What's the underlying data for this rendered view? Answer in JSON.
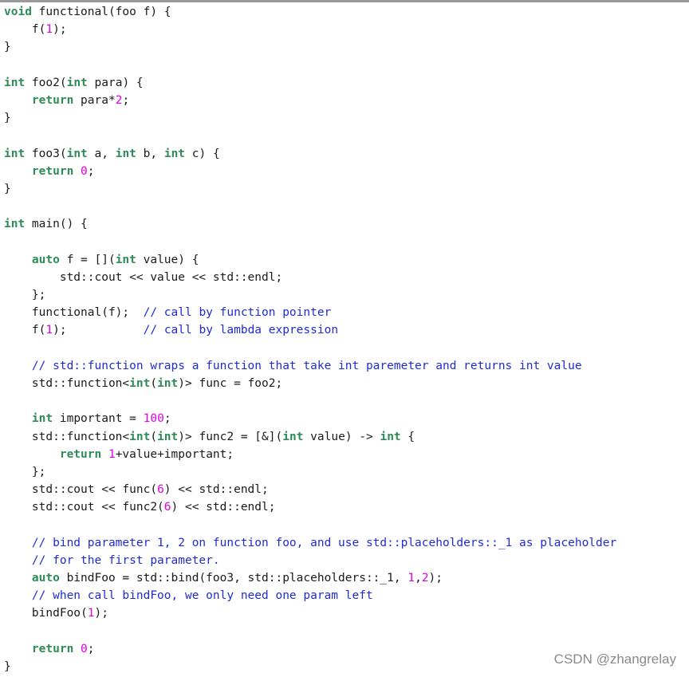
{
  "watermark": "CSDN @zhangrelay",
  "colors": {
    "keyword": "#2e8b57",
    "number": "#e000e0",
    "comment": "#1e2bd8",
    "text": "#1a1a1a",
    "background": "#ffffff"
  },
  "lines": [
    [
      [
        "kw",
        "void"
      ],
      [
        "t",
        " functional(foo f) {"
      ]
    ],
    [
      [
        "t",
        "    f("
      ],
      [
        "num",
        "1"
      ],
      [
        "t",
        ");"
      ]
    ],
    [
      [
        "t",
        "}"
      ]
    ],
    [],
    [
      [
        "kw",
        "int"
      ],
      [
        "t",
        " foo2("
      ],
      [
        "kw",
        "int"
      ],
      [
        "t",
        " para) {"
      ]
    ],
    [
      [
        "t",
        "    "
      ],
      [
        "kw",
        "return"
      ],
      [
        "t",
        " para*"
      ],
      [
        "num",
        "2"
      ],
      [
        "t",
        ";"
      ]
    ],
    [
      [
        "t",
        "}"
      ]
    ],
    [],
    [
      [
        "kw",
        "int"
      ],
      [
        "t",
        " foo3("
      ],
      [
        "kw",
        "int"
      ],
      [
        "t",
        " a, "
      ],
      [
        "kw",
        "int"
      ],
      [
        "t",
        " b, "
      ],
      [
        "kw",
        "int"
      ],
      [
        "t",
        " c) {"
      ]
    ],
    [
      [
        "t",
        "    "
      ],
      [
        "kw",
        "return"
      ],
      [
        "t",
        " "
      ],
      [
        "num",
        "0"
      ],
      [
        "t",
        ";"
      ]
    ],
    [
      [
        "t",
        "}"
      ]
    ],
    [],
    [
      [
        "kw",
        "int"
      ],
      [
        "t",
        " main() {"
      ]
    ],
    [],
    [
      [
        "t",
        "    "
      ],
      [
        "kw",
        "auto"
      ],
      [
        "t",
        " f = []("
      ],
      [
        "kw",
        "int"
      ],
      [
        "t",
        " value) {"
      ]
    ],
    [
      [
        "t",
        "        std::cout << value << std::endl;"
      ]
    ],
    [
      [
        "t",
        "    };"
      ]
    ],
    [
      [
        "t",
        "    functional(f);  "
      ],
      [
        "cm",
        "// call by function pointer"
      ]
    ],
    [
      [
        "t",
        "    f("
      ],
      [
        "num",
        "1"
      ],
      [
        "t",
        ");           "
      ],
      [
        "cm",
        "// call by lambda expression"
      ]
    ],
    [],
    [
      [
        "t",
        "    "
      ],
      [
        "cm",
        "// std::function wraps a function that take int paremeter and returns int value"
      ]
    ],
    [
      [
        "t",
        "    std::function<"
      ],
      [
        "kw",
        "int"
      ],
      [
        "t",
        "("
      ],
      [
        "kw",
        "int"
      ],
      [
        "t",
        ")> func = foo2;"
      ]
    ],
    [],
    [
      [
        "t",
        "    "
      ],
      [
        "kw",
        "int"
      ],
      [
        "t",
        " important = "
      ],
      [
        "num",
        "100"
      ],
      [
        "t",
        ";"
      ]
    ],
    [
      [
        "t",
        "    std::function<"
      ],
      [
        "kw",
        "int"
      ],
      [
        "t",
        "("
      ],
      [
        "kw",
        "int"
      ],
      [
        "t",
        ")> func2 = [&]("
      ],
      [
        "kw",
        "int"
      ],
      [
        "t",
        " value) -> "
      ],
      [
        "kw",
        "int"
      ],
      [
        "t",
        " {"
      ]
    ],
    [
      [
        "t",
        "        "
      ],
      [
        "kw",
        "return"
      ],
      [
        "t",
        " "
      ],
      [
        "num",
        "1"
      ],
      [
        "t",
        "+value+important;"
      ]
    ],
    [
      [
        "t",
        "    };"
      ]
    ],
    [
      [
        "t",
        "    std::cout << func("
      ],
      [
        "num",
        "6"
      ],
      [
        "t",
        ") << std::endl;"
      ]
    ],
    [
      [
        "t",
        "    std::cout << func2("
      ],
      [
        "num",
        "6"
      ],
      [
        "t",
        ") << std::endl;"
      ]
    ],
    [],
    [
      [
        "t",
        "    "
      ],
      [
        "cm",
        "// bind parameter 1, 2 on function foo, and use std::placeholders::_1 as placeholder"
      ]
    ],
    [
      [
        "t",
        "    "
      ],
      [
        "cm",
        "// for the first parameter."
      ]
    ],
    [
      [
        "t",
        "    "
      ],
      [
        "kw",
        "auto"
      ],
      [
        "t",
        " bindFoo = std::bind(foo3, std::placeholders::_1, "
      ],
      [
        "num",
        "1"
      ],
      [
        "t",
        ","
      ],
      [
        "num",
        "2"
      ],
      [
        "t",
        ");"
      ]
    ],
    [
      [
        "t",
        "    "
      ],
      [
        "cm",
        "// when call bindFoo, we only need one param left"
      ]
    ],
    [
      [
        "t",
        "    bindFoo("
      ],
      [
        "num",
        "1"
      ],
      [
        "t",
        ");"
      ]
    ],
    [],
    [
      [
        "t",
        "    "
      ],
      [
        "kw",
        "return"
      ],
      [
        "t",
        " "
      ],
      [
        "num",
        "0"
      ],
      [
        "t",
        ";"
      ]
    ],
    [
      [
        "t",
        "}"
      ]
    ]
  ]
}
